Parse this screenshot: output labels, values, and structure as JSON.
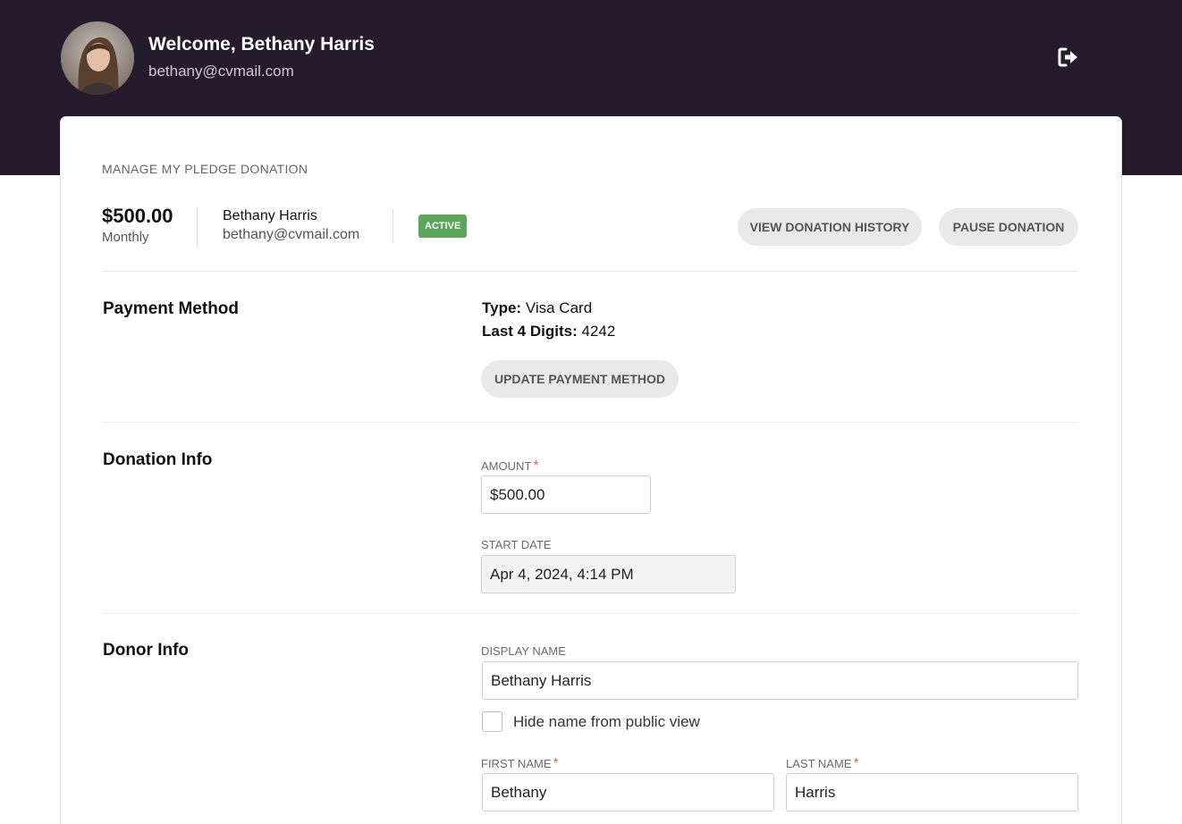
{
  "header": {
    "welcome": "Welcome, Bethany Harris",
    "email": "bethany@cvmail.com",
    "logout_icon": "sign-out-icon"
  },
  "summary": {
    "section_title": "MANAGE MY PLEDGE DONATION",
    "amount": "$500.00",
    "frequency": "Monthly",
    "donor_name": "Bethany Harris",
    "donor_email": "bethany@cvmail.com",
    "status": "ACTIVE",
    "status_color": "#5ba65b",
    "view_history_label": "VIEW DONATION HISTORY",
    "pause_label": "PAUSE DONATION"
  },
  "payment": {
    "title": "Payment Method",
    "type_label": "Type:",
    "type_value": "Visa Card",
    "digits_label": "Last 4 Digits:",
    "digits_value": "4242",
    "update_label": "UPDATE PAYMENT METHOD"
  },
  "donation": {
    "title": "Donation Info",
    "amount_label": "AMOUNT",
    "amount_value": "$500.00",
    "start_label": "START DATE",
    "start_value": "Apr 4, 2024, 4:14 PM"
  },
  "donor": {
    "title": "Donor Info",
    "display_label": "DISPLAY NAME",
    "display_value": "Bethany Harris",
    "hide_label": "Hide name from public view",
    "first_label": "FIRST NAME",
    "first_value": "Bethany",
    "last_label": "LAST NAME",
    "last_value": "Harris"
  },
  "colors": {
    "header_bg": "#241b2c",
    "required": "#c87660"
  }
}
